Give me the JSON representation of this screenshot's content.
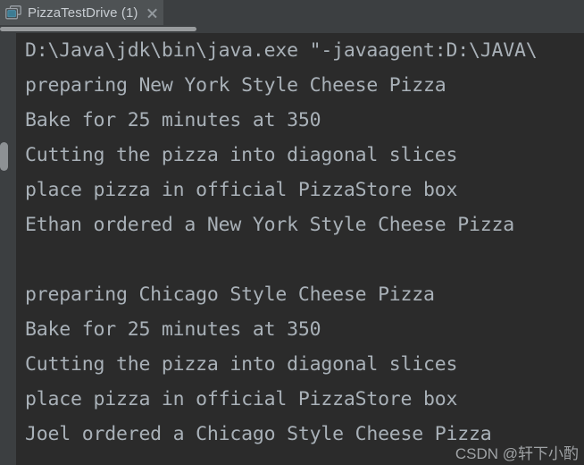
{
  "tab": {
    "icon": "console-window-icon",
    "label": "PizzaTestDrive (1)",
    "close_icon": "close-icon"
  },
  "colors": {
    "tabbar_bg": "#3c3f41",
    "tab_active_bg": "#4e5254",
    "console_bg": "#2b2b2b",
    "console_text": "#a9b1b8",
    "tab_text": "#c8cdd2",
    "scrollbar_thumb": "#989b9d",
    "icon_accent": "#4e8fa8"
  },
  "console": {
    "name": "run-console-output",
    "lines": [
      "D:\\Java\\jdk\\bin\\java.exe \"-javaagent:D:\\JAVA\\",
      "preparing New York Style Cheese Pizza",
      "Bake for 25 minutes at 350",
      "Cutting the pizza into diagonal slices",
      "place pizza in official PizzaStore box",
      "Ethan ordered a New York Style Cheese Pizza",
      "",
      "preparing Chicago Style Cheese Pizza",
      "Bake for 25 minutes at 350",
      "Cutting the pizza into diagonal slices",
      "place pizza in official PizzaStore box",
      "Joel ordered a Chicago Style Cheese Pizza"
    ]
  },
  "scrollbars": {
    "horizontal_label": "horizontal-scrollbar",
    "vertical_label": "vertical-scrollbar"
  },
  "watermark": {
    "text": "CSDN @轩下小酌"
  }
}
